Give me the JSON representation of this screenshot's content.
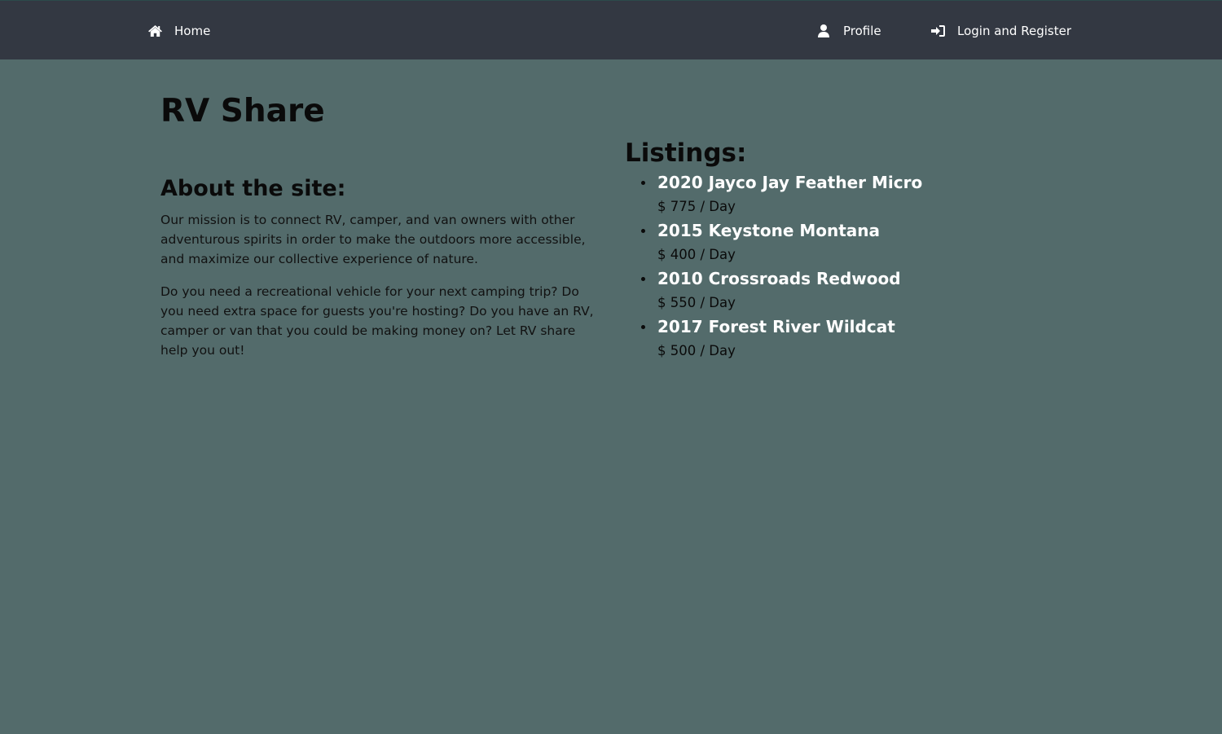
{
  "nav": {
    "home": {
      "label": "Home",
      "icon": "home-icon"
    },
    "profile": {
      "label": "Profile",
      "icon": "user-icon"
    },
    "login": {
      "label": "Login and Register",
      "icon": "sign-in-icon"
    }
  },
  "page": {
    "title": "RV Share"
  },
  "about": {
    "heading": "About the site:",
    "paragraphs": [
      "Our mission is to connect RV, camper, and van owners with other adventurous spirits in order to make the outdoors more accessible, and maximize our collective experience of nature.",
      "Do you need a recreational vehicle for your next camping trip? Do you need extra space for guests you're hosting? Do you have an RV, camper or van that you could be making money on? Let RV share help you out!"
    ]
  },
  "listings": {
    "heading": "Listings:",
    "items": [
      {
        "name": "2020 Jayco Jay Feather Micro",
        "price": "$ 775 / Day"
      },
      {
        "name": "2015 Keystone Montana",
        "price": "$ 400 / Day"
      },
      {
        "name": "2010 Crossroads Redwood",
        "price": "$ 550 / Day"
      },
      {
        "name": "2017 Forest River Wildcat",
        "price": "$ 500 / Day"
      }
    ]
  },
  "colors": {
    "background": "#536b6b",
    "navbar": "#333842",
    "listing_name": "#ffffff"
  }
}
